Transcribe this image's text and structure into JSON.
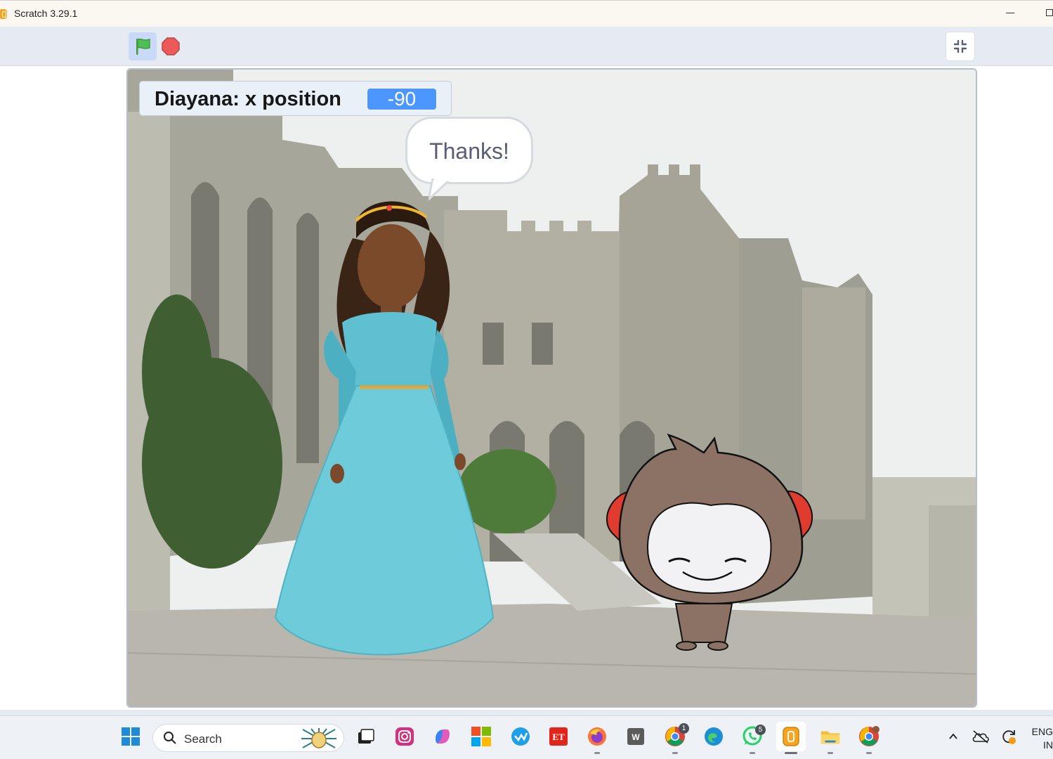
{
  "window": {
    "title": "Scratch 3.29.1",
    "app_icon": "scratch-app-icon"
  },
  "toolbar": {
    "green_flag_icon": "green-flag-icon",
    "stop_icon": "stop-icon",
    "unfullscreen_icon": "unfullscreen-icon"
  },
  "stage": {
    "monitor": {
      "label": "Diayana: x position",
      "value": "-90"
    },
    "speech_bubble": {
      "text": "Thanks!"
    },
    "sprites": [
      "Diayana",
      "Chick-like creature"
    ],
    "backdrop": "castle courtyard"
  },
  "taskbar": {
    "search_placeholder": "Search",
    "whatsapp_badge": "5",
    "chrome_badge": "1",
    "language": {
      "line1": "ENG",
      "line2": "IN"
    },
    "apps": [
      "windows-start",
      "search",
      "task-view",
      "instagram",
      "copilot",
      "microsoft-store",
      "wave-app",
      "et-app",
      "firefox",
      "word-app",
      "chrome",
      "edge",
      "whatsapp",
      "scratch",
      "file-explorer",
      "chrome-profile"
    ]
  },
  "colors": {
    "accent_blue": "#4c97ff",
    "toolbar_bg": "#e6ebf3",
    "flag_green": "#4cbf56",
    "stop_red": "#ec5959",
    "dress": "#6ecbd9"
  }
}
